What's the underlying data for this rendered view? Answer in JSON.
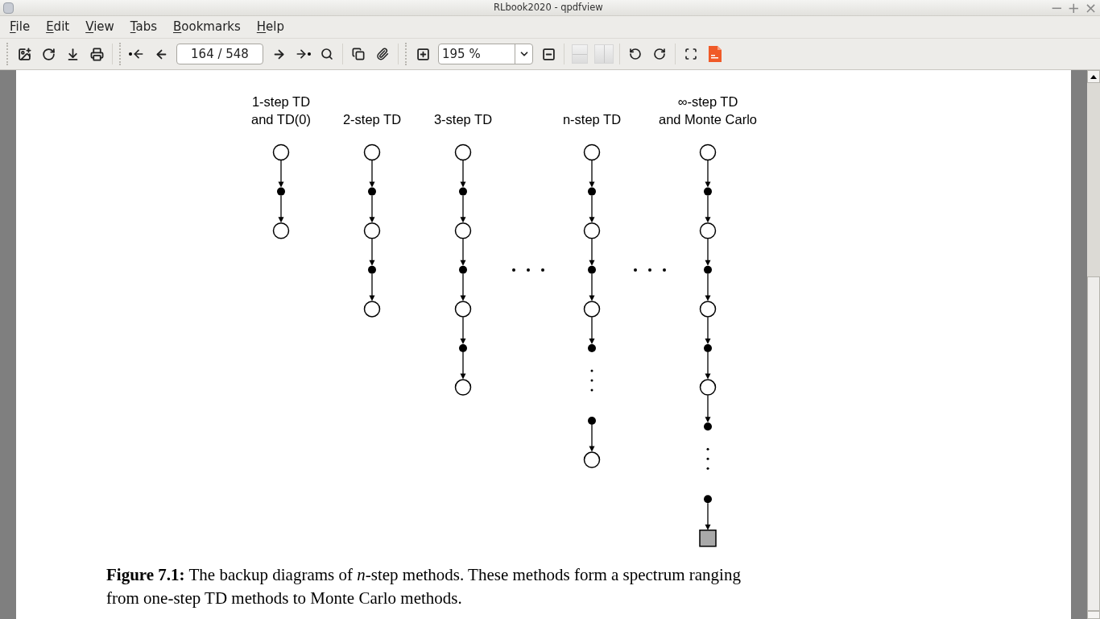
{
  "window": {
    "title": "RLbook2020 - qpdfview",
    "controls": [
      "−",
      "+",
      "×"
    ]
  },
  "menu": [
    {
      "label": "File"
    },
    {
      "label": "Edit"
    },
    {
      "label": "View"
    },
    {
      "label": "Tabs"
    },
    {
      "label": "Bookmarks"
    },
    {
      "label": "Help"
    }
  ],
  "toolbar": {
    "page": "164 / 548",
    "zoom": "195 %",
    "continuous": {
      "disabled": true
    },
    "two_pages": {
      "disabled": true
    }
  },
  "figure": {
    "columns": [
      {
        "kind": "column",
        "label": [
          "1-step TD",
          "and TD(0)"
        ],
        "nodes": [
          {
            "kind": "state"
          },
          {
            "kind": "action"
          },
          {
            "kind": "state"
          }
        ]
      },
      {
        "kind": "column",
        "label": [
          "2-step TD"
        ],
        "nodes": [
          {
            "kind": "state"
          },
          {
            "kind": "action"
          },
          {
            "kind": "state"
          },
          {
            "kind": "action"
          },
          {
            "kind": "state"
          }
        ]
      },
      {
        "kind": "column",
        "label": [
          "3-step TD"
        ],
        "nodes": [
          {
            "kind": "state"
          },
          {
            "kind": "action"
          },
          {
            "kind": "state"
          },
          {
            "kind": "action"
          },
          {
            "kind": "state"
          },
          {
            "kind": "action"
          },
          {
            "kind": "state"
          }
        ]
      },
      {
        "kind": "ellipsis"
      },
      {
        "kind": "column",
        "label": [
          "n-step TD"
        ],
        "nodes": [
          {
            "kind": "state"
          },
          {
            "kind": "action"
          },
          {
            "kind": "state"
          },
          {
            "kind": "action"
          },
          {
            "kind": "state"
          },
          {
            "kind": "action"
          },
          {
            "kind": "vdots"
          },
          {
            "kind": "action"
          },
          {
            "kind": "state"
          }
        ]
      },
      {
        "kind": "ellipsis"
      },
      {
        "kind": "column",
        "label": [
          "∞-step TD",
          "and Monte Carlo"
        ],
        "nodes": [
          {
            "kind": "state"
          },
          {
            "kind": "action"
          },
          {
            "kind": "state"
          },
          {
            "kind": "action"
          },
          {
            "kind": "state"
          },
          {
            "kind": "action"
          },
          {
            "kind": "state"
          },
          {
            "kind": "action"
          },
          {
            "kind": "vdots"
          },
          {
            "kind": "action"
          },
          {
            "kind": "terminal"
          }
        ]
      }
    ],
    "caption": [
      "**Figure 7.1:** The backup diagrams of *n*-step methods. These methods form a spectrum ranging",
      "from one-step TD methods to Monte Carlo methods."
    ]
  }
}
